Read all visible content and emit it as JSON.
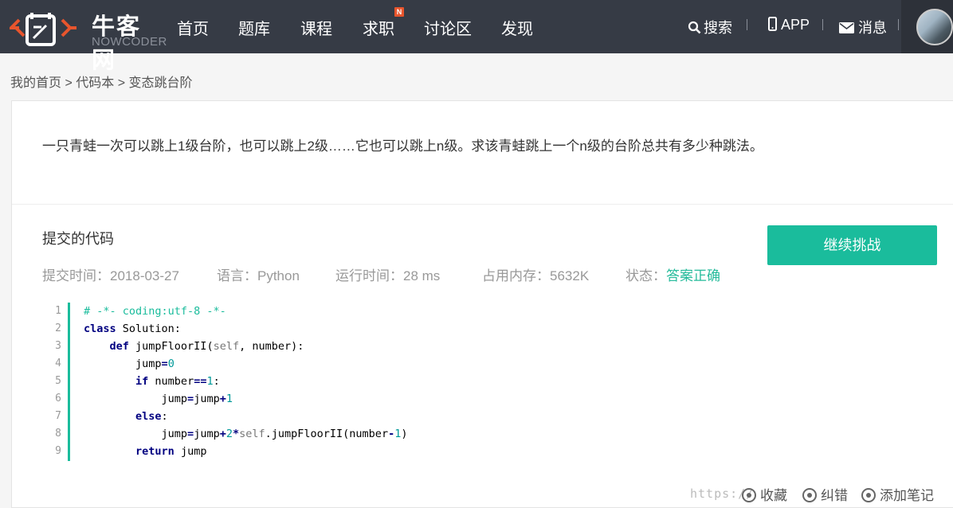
{
  "header": {
    "logo_cn": "牛客网",
    "logo_en": "NOWCODER",
    "nav": [
      {
        "label": "首页"
      },
      {
        "label": "题库"
      },
      {
        "label": "课程"
      },
      {
        "label": "求职",
        "badge": "N"
      },
      {
        "label": "讨论区"
      },
      {
        "label": "发现"
      }
    ],
    "search_label": "搜索",
    "app_label": "APP",
    "message_label": "消息",
    "accent_color": "#1abc9c",
    "bg_color": "#363b45"
  },
  "breadcrumb": {
    "home": "我的首页",
    "sep1": " > ",
    "codebook": "代码本",
    "sep2": " > ",
    "current": "变态跳台阶"
  },
  "question": "一只青蛙一次可以跳上1级台阶，也可以跳上2级……它也可以跳上n级。求该青蛙跳上一个n级的台阶总共有多少种跳法。",
  "submission": {
    "title": "提交的代码",
    "continue_button": "继续挑战",
    "meta": {
      "time_label": "提交时间：",
      "time_value": "2018-03-27",
      "lang_label": "语言：",
      "lang_value": "Python",
      "run_label": "运行时间：",
      "run_value": "28 ms",
      "mem_label": "占用内存：",
      "mem_value": "5632K",
      "status_label": "状态：",
      "status_value": "答案正确"
    }
  },
  "code": {
    "line_numbers": [
      "1",
      "2",
      "3",
      "4",
      "5",
      "6",
      "7",
      "8",
      "9"
    ],
    "lines": [
      "# -*- coding:utf-8 -*-",
      "class Solution:",
      "    def jumpFloorII(self, number):",
      "        jump=0",
      "        if number==1:",
      "            jump=jump+1",
      "        else:",
      "            jump=jump+2*self.jumpFloorII(number-1)",
      "        return jump"
    ]
  },
  "actions": {
    "collect": "收藏",
    "correct": "纠错",
    "note": "添加笔记",
    "watermark": "https://"
  }
}
